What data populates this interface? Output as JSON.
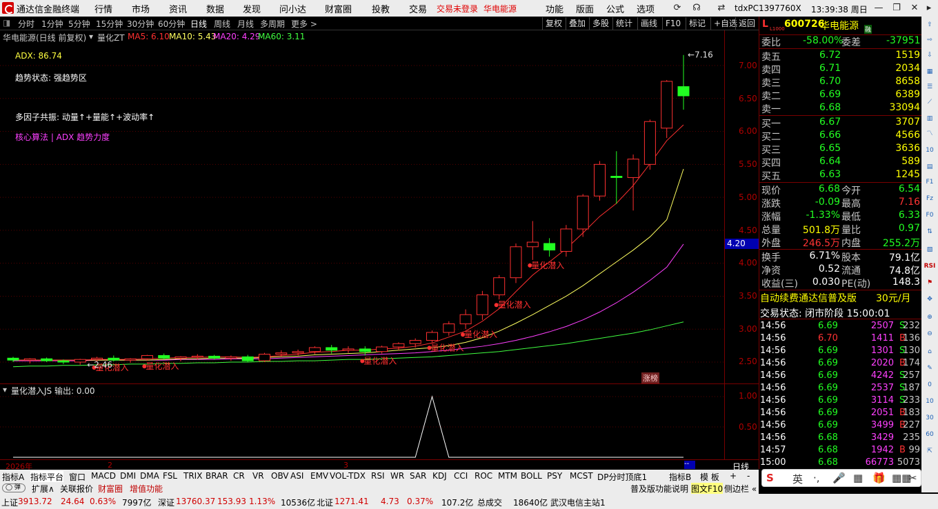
{
  "menu": {
    "app_title": "通达信金融终端",
    "items": [
      "行情",
      "市场",
      "资讯",
      "数据",
      "发现",
      "问小达",
      "财富圈",
      "投教",
      "交易"
    ],
    "alert": "交易未登录",
    "alert_stock": "华电能源",
    "right_items": [
      "功能",
      "版面",
      "公式",
      "选项"
    ],
    "host": "tdxPC1397760X",
    "clock": "13:39:38 周日"
  },
  "periods": [
    "分时",
    "1分钟",
    "5分钟",
    "15分钟",
    "30分钟",
    "60分钟",
    "日线",
    "周线",
    "月线",
    "多周期",
    "更多 >"
  ],
  "right_tools": [
    "复权",
    "叠加",
    "多股",
    "统计",
    "画线",
    "F10",
    "标记",
    "+自选",
    "返回"
  ],
  "chart_header": {
    "name": "华电能源(日线 前复权)",
    "indicator": "量化ZT",
    "ma5": "MA5: 6.10",
    "ma10": "MA10: 5.43",
    "ma20": "MA20: 4.29",
    "ma60": "MA60: 3.11"
  },
  "overlay": {
    "adx": "ADX: 86.74",
    "trend": "趋势状态: 强趋势区",
    "factors": "多因子共振: 动量↑+量能↑+波动率↑",
    "core": "核心算法 | ADX 趋势力度"
  },
  "price_axis": [
    "7.00",
    "6.50",
    "6.00",
    "5.50",
    "5.00",
    "4.50",
    "4.00",
    "3.50",
    "3.00",
    "2.50"
  ],
  "price_box": "4.20",
  "max_label": "7.16",
  "min_label": "2.46",
  "signal_label": "量化潜入",
  "limit_tag": "涨榜",
  "sub_header": "量化潜入JS  输出: 0.00",
  "sub_axis": [
    "1.00",
    "0.50"
  ],
  "date_labels": [
    "2026年",
    "2",
    "3"
  ],
  "period_tag": "日线",
  "chart_data": {
    "type": "candlestick",
    "y_range": [
      2.3,
      7.3
    ],
    "candles": [
      [
        2.56,
        2.58,
        2.5,
        2.53
      ],
      [
        2.53,
        2.56,
        2.48,
        2.55
      ],
      [
        2.55,
        2.57,
        2.5,
        2.52
      ],
      [
        2.52,
        2.54,
        2.47,
        2.5
      ],
      [
        2.5,
        2.55,
        2.46,
        2.54
      ],
      [
        2.54,
        2.58,
        2.5,
        2.56
      ],
      [
        2.56,
        2.6,
        2.51,
        2.53
      ],
      [
        2.53,
        2.56,
        2.49,
        2.55
      ],
      [
        2.55,
        2.61,
        2.52,
        2.6
      ],
      [
        2.6,
        2.63,
        2.54,
        2.56
      ],
      [
        2.56,
        2.59,
        2.51,
        2.58
      ],
      [
        2.58,
        2.62,
        2.54,
        2.59
      ],
      [
        2.59,
        2.61,
        2.54,
        2.56
      ],
      [
        2.56,
        2.6,
        2.52,
        2.58
      ],
      [
        2.58,
        2.61,
        2.5,
        2.52
      ],
      [
        2.52,
        2.64,
        2.5,
        2.62
      ],
      [
        2.62,
        2.68,
        2.58,
        2.64
      ],
      [
        2.64,
        2.69,
        2.6,
        2.66
      ],
      [
        2.66,
        2.74,
        2.62,
        2.72
      ],
      [
        2.72,
        2.76,
        2.63,
        2.68
      ],
      [
        2.68,
        2.74,
        2.64,
        2.7
      ],
      [
        2.7,
        2.74,
        2.6,
        2.66
      ],
      [
        2.66,
        2.75,
        2.63,
        2.73
      ],
      [
        2.73,
        2.8,
        2.68,
        2.78
      ],
      [
        2.78,
        2.86,
        2.72,
        2.83
      ],
      [
        2.83,
        2.98,
        2.8,
        2.95
      ],
      [
        2.95,
        3.12,
        2.9,
        3.08
      ],
      [
        3.08,
        3.3,
        3.0,
        3.22
      ],
      [
        3.22,
        3.58,
        3.14,
        3.52
      ],
      [
        3.52,
        3.82,
        3.45,
        3.78
      ],
      [
        3.78,
        4.3,
        3.7,
        4.25
      ],
      [
        4.25,
        4.64,
        4.05,
        4.32
      ],
      [
        4.3,
        4.38,
        4.1,
        4.2
      ],
      [
        4.18,
        4.58,
        4.1,
        4.52
      ],
      [
        4.52,
        5.05,
        4.4,
        5.02
      ],
      [
        5.02,
        5.55,
        4.95,
        5.5
      ],
      [
        5.32,
        5.7,
        4.9,
        5.3
      ],
      [
        5.3,
        5.65,
        4.8,
        5.58
      ],
      [
        5.5,
        6.18,
        5.42,
        6.15
      ],
      [
        6.05,
        6.78,
        5.9,
        6.76
      ],
      [
        6.68,
        7.16,
        6.33,
        6.54
      ]
    ],
    "ma": {
      "MA5": [
        2.53,
        2.53,
        2.53,
        2.53,
        2.53,
        2.54,
        2.54,
        2.54,
        2.55,
        2.56,
        2.57,
        2.57,
        2.58,
        2.58,
        2.57,
        2.58,
        2.6,
        2.62,
        2.65,
        2.66,
        2.68,
        2.68,
        2.7,
        2.71,
        2.74,
        2.79,
        2.88,
        2.97,
        3.12,
        3.31,
        3.57,
        3.82,
        4.02,
        4.22,
        4.46,
        4.71,
        4.91,
        5.18,
        5.51,
        5.86,
        6.1
      ],
      "MA10": [
        2.53,
        2.53,
        2.53,
        2.53,
        2.53,
        2.53,
        2.53,
        2.53,
        2.53,
        2.54,
        2.55,
        2.55,
        2.56,
        2.56,
        2.56,
        2.57,
        2.58,
        2.59,
        2.61,
        2.62,
        2.63,
        2.64,
        2.66,
        2.68,
        2.7,
        2.72,
        2.75,
        2.8,
        2.87,
        2.97,
        3.09,
        3.22,
        3.36,
        3.5,
        3.66,
        3.84,
        4.02,
        4.2,
        4.4,
        4.66,
        5.43
      ],
      "MA20": [
        2.52,
        2.52,
        2.52,
        2.52,
        2.52,
        2.53,
        2.53,
        2.53,
        2.53,
        2.53,
        2.54,
        2.54,
        2.54,
        2.55,
        2.55,
        2.55,
        2.56,
        2.57,
        2.58,
        2.59,
        2.6,
        2.61,
        2.62,
        2.63,
        2.64,
        2.66,
        2.68,
        2.71,
        2.74,
        2.78,
        2.83,
        2.89,
        2.96,
        3.04,
        3.14,
        3.26,
        3.4,
        3.56,
        3.74,
        3.94,
        4.29
      ],
      "MA60": [
        2.43,
        2.44,
        2.44,
        2.45,
        2.45,
        2.46,
        2.46,
        2.47,
        2.47,
        2.48,
        2.48,
        2.49,
        2.49,
        2.5,
        2.5,
        2.51,
        2.51,
        2.52,
        2.52,
        2.53,
        2.54,
        2.54,
        2.55,
        2.56,
        2.57,
        2.58,
        2.6,
        2.62,
        2.64,
        2.66,
        2.69,
        2.72,
        2.75,
        2.78,
        2.82,
        2.86,
        2.9,
        2.94,
        2.99,
        3.05,
        3.11
      ]
    },
    "ma_colors": {
      "MA5": "#ff3030",
      "MA10": "#ffff60",
      "MA20": "#ff40ff",
      "MA60": "#40ff40"
    },
    "signals": [
      5,
      8,
      21,
      25,
      27,
      29,
      31
    ],
    "sub_spike": {
      "index": 25,
      "value": 1.0
    }
  },
  "quote": {
    "code": "600726",
    "name": "华电能源",
    "tag": "L1000",
    "margin": "融",
    "wb_label": "委比",
    "wb": "-58.00%",
    "wc_label": "委差",
    "wc": "-37951",
    "asks": [
      {
        "label": "卖五",
        "price": "6.72",
        "vol": "1519"
      },
      {
        "label": "卖四",
        "price": "6.71",
        "vol": "2034"
      },
      {
        "label": "卖三",
        "price": "6.70",
        "vol": "8658"
      },
      {
        "label": "卖二",
        "price": "6.69",
        "vol": "6389"
      },
      {
        "label": "卖一",
        "price": "6.68",
        "vol": "33094"
      }
    ],
    "bids": [
      {
        "label": "买一",
        "price": "6.67",
        "vol": "3707"
      },
      {
        "label": "买二",
        "price": "6.66",
        "vol": "4566"
      },
      {
        "label": "买三",
        "price": "6.65",
        "vol": "3636"
      },
      {
        "label": "买四",
        "price": "6.64",
        "vol": "589"
      },
      {
        "label": "买五",
        "price": "6.63",
        "vol": "1245"
      }
    ],
    "stats": [
      {
        "l": "现价",
        "v": "6.68",
        "l2": "今开",
        "v2": "6.54",
        "c": "green",
        "c2": "green"
      },
      {
        "l": "涨跌",
        "v": "-0.09",
        "l2": "最高",
        "v2": "7.16",
        "c": "green",
        "c2": "red"
      },
      {
        "l": "涨幅",
        "v": "-1.33%",
        "l2": "最低",
        "v2": "6.33",
        "c": "green",
        "c2": "green"
      },
      {
        "l": "总量",
        "v": "501.8万",
        "l2": "量比",
        "v2": "0.97",
        "c": "yel",
        "c2": "green"
      },
      {
        "l": "外盘",
        "v": "246.5万",
        "l2": "内盘",
        "v2": "255.2万",
        "c": "red",
        "c2": "green"
      }
    ],
    "stats2": [
      {
        "l": "换手",
        "v": "6.71%",
        "l2": "股本",
        "v2": "79.1亿"
      },
      {
        "l": "净资",
        "v": "0.52",
        "l2": "流通",
        "v2": "74.8亿"
      },
      {
        "l": "收益(三)",
        "v": "0.030",
        "l2": "PE(动)",
        "v2": "148.3"
      }
    ],
    "promo": "自动续费通达信普及版",
    "promo_price": "30元/月",
    "trade_state": "交易状态: 闭市阶段 15:00:01",
    "ticks": [
      {
        "t": "14:56",
        "p": "6.69",
        "v": "2507",
        "s": "S",
        "n": "232"
      },
      {
        "t": "14:56",
        "p": "6.70",
        "v": "1411",
        "s": "B",
        "n": "136"
      },
      {
        "t": "14:56",
        "p": "6.69",
        "v": "1301",
        "s": "S",
        "n": "130"
      },
      {
        "t": "14:56",
        "p": "6.69",
        "v": "2020",
        "s": "B",
        "n": "174"
      },
      {
        "t": "14:56",
        "p": "6.69",
        "v": "4242",
        "s": "S",
        "n": "257"
      },
      {
        "t": "14:56",
        "p": "6.69",
        "v": "2537",
        "s": "S",
        "n": "187"
      },
      {
        "t": "14:56",
        "p": "6.69",
        "v": "3114",
        "s": "S",
        "n": "233"
      },
      {
        "t": "14:56",
        "p": "6.69",
        "v": "2051",
        "s": "B",
        "n": "183"
      },
      {
        "t": "14:56",
        "p": "6.69",
        "v": "3499",
        "s": "B",
        "n": "227"
      },
      {
        "t": "14:56",
        "p": "6.68",
        "v": "3429",
        "s": "",
        "n": "235"
      },
      {
        "t": "14:57",
        "p": "6.68",
        "v": "1942",
        "s": "B",
        "n": "99"
      },
      {
        "t": "15:00",
        "p": "6.68",
        "v": "66773",
        "s": "",
        "n": "5073"
      }
    ]
  },
  "bottom_tabs": [
    "指标A",
    "指标平台",
    "窗口",
    "MACD",
    "DMI",
    "DMA",
    "FSL",
    "TRIX",
    "BRAR",
    "CR",
    "VR",
    "OBV",
    "ASI",
    "EMV",
    "VOL-TDX",
    "RSI",
    "WR",
    "SAR",
    "KDJ",
    "CCI",
    "ROC",
    "MTM",
    "BOLL",
    "PSY",
    "MCST",
    "DP分时顶底1"
  ],
  "bottom_right": [
    "指标B",
    "模 板",
    "+",
    "-"
  ],
  "bottom2": [
    "扩展∧",
    "关联报价",
    "财富圈",
    "增值功能"
  ],
  "bottom2_right": [
    "普及版功能说明",
    "图文F10",
    "侧边栏 «"
  ],
  "status": {
    "sh_label": "上证",
    "sh": "3913.72",
    "sh_chg": "24.64",
    "sh_pct": "0.63%",
    "sh_amt": "7997亿",
    "sz_label": "深证",
    "sz": "13760.37",
    "sz_chg": "153.93",
    "sz_pct": "1.13%",
    "sz_amt": "10536亿",
    "bz_label": "北证",
    "bz": "1271.41",
    "bz_chg": "4.73",
    "bz_pct": "0.37%",
    "bz_amt": "107.2亿",
    "total_label": "总成交",
    "total": "18640亿",
    "server": "武汉电信主站1"
  },
  "ime": [
    "英",
    "·,",
    "🎤",
    "▦",
    "🎁",
    "▦▦",
    "✂"
  ]
}
